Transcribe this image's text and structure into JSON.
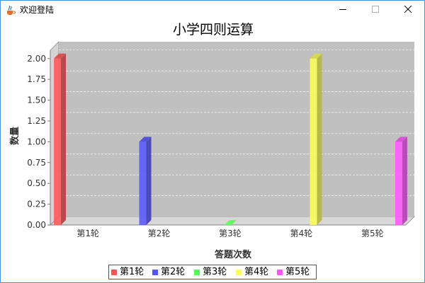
{
  "window": {
    "title": "欢迎登陆",
    "buttons": {
      "minimize": "—",
      "maximize": "☐",
      "close": "✕"
    }
  },
  "chart_data": {
    "type": "bar",
    "title": "小学四则运算",
    "xlabel": "答题次数",
    "ylabel": "数量",
    "categories": [
      "第1轮",
      "第2轮",
      "第3轮",
      "第4轮",
      "第5轮"
    ],
    "series": [
      {
        "name": "第1轮",
        "color": "#ff5555",
        "values": [
          2,
          0,
          0,
          0,
          0
        ]
      },
      {
        "name": "第2轮",
        "color": "#5555ff",
        "values": [
          0,
          1,
          0,
          0,
          0
        ]
      },
      {
        "name": "第3轮",
        "color": "#55ff55",
        "values": [
          0,
          0,
          0,
          0,
          0
        ]
      },
      {
        "name": "第4轮",
        "color": "#ffff55",
        "values": [
          0,
          0,
          0,
          2,
          0
        ]
      },
      {
        "name": "第5轮",
        "color": "#ff55ff",
        "values": [
          0,
          0,
          0,
          0,
          1
        ]
      }
    ],
    "ylim": [
      0,
      2.1
    ],
    "yticks": [
      "0.00",
      "0.25",
      "0.50",
      "0.75",
      "1.00",
      "1.25",
      "1.50",
      "1.75",
      "2.00"
    ],
    "grid": true,
    "legend_position": "bottom",
    "style": "3d"
  }
}
